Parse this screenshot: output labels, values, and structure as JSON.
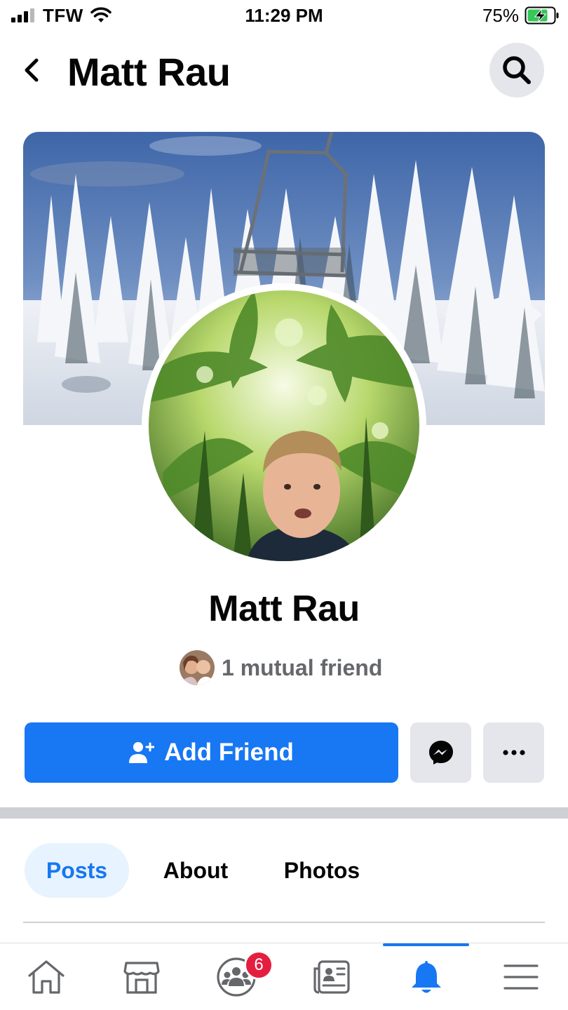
{
  "status_bar": {
    "carrier": "TFW",
    "time": "11:29 PM",
    "battery_percent": "75%",
    "battery_level": 0.75
  },
  "header": {
    "title": "Matt Rau"
  },
  "profile": {
    "name": "Matt Rau",
    "mutual_friends": "1 mutual friend"
  },
  "actions": {
    "add_friend_label": "Add Friend"
  },
  "tabs": [
    {
      "label": "Posts",
      "active": true
    },
    {
      "label": "About",
      "active": false
    },
    {
      "label": "Photos",
      "active": false
    }
  ],
  "bottom_nav": {
    "items": [
      "home-icon",
      "marketplace-icon",
      "groups-icon",
      "news-icon",
      "notifications-icon",
      "menu-icon"
    ],
    "active": "notifications-icon",
    "groups_badge": "6"
  },
  "colors": {
    "accent": "#1877f2",
    "button_gray": "#e4e6eb",
    "badge_red": "#e41e3f",
    "secondary_text": "#65676b"
  }
}
